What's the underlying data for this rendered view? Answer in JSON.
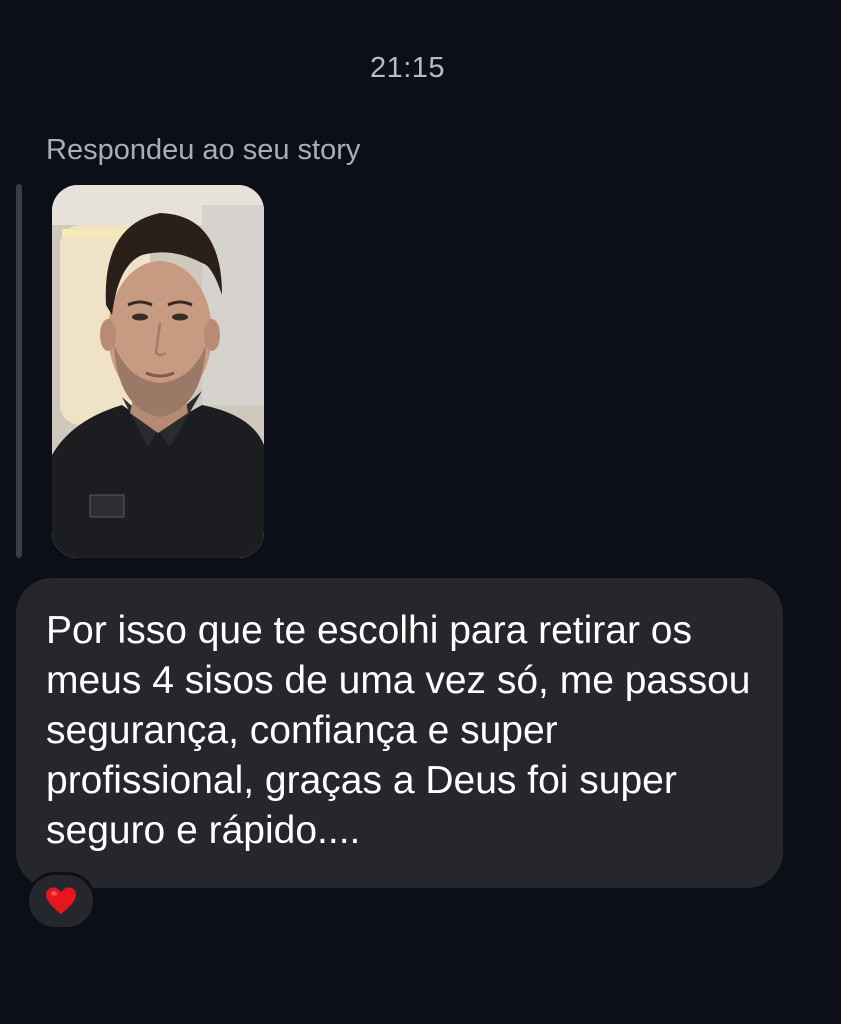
{
  "conversation": {
    "timestamp": "21:15",
    "reply_context": "Respondeu ao seu story",
    "message_text": "Por isso que te escolhi para retirar os meus 4 sisos de uma vez só, me passou segurança, confiança e super profissional, graças a Deus foi super seguro e rápido....",
    "reaction": {
      "icon": "heart-icon",
      "color": "#e5161f"
    }
  },
  "colors": {
    "background": "#0c0f17",
    "bubble": "#26272c",
    "muted_text": "#a9adb6"
  }
}
